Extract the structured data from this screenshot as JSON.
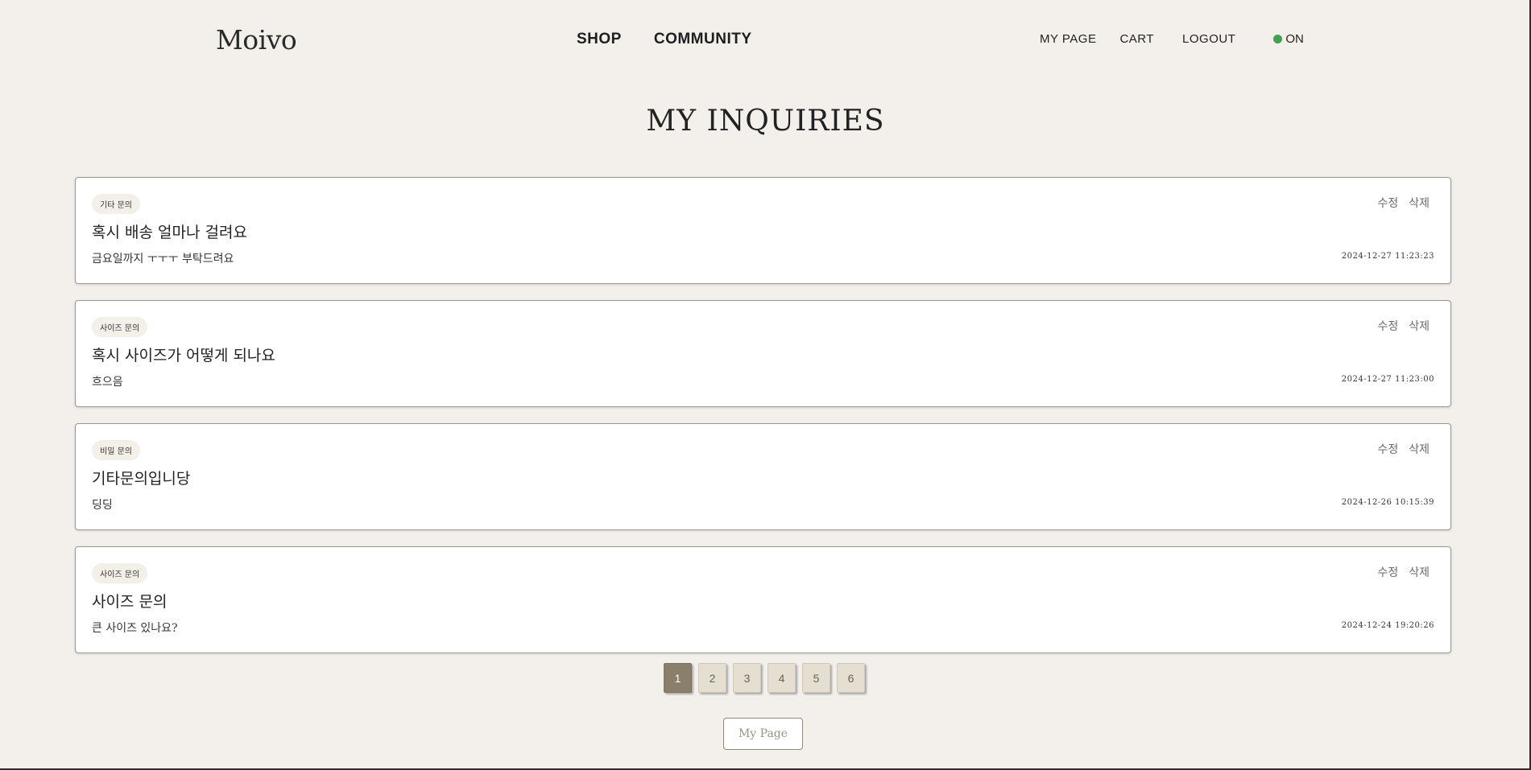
{
  "header": {
    "logo": "Moivo",
    "nav": {
      "shop": "SHOP",
      "community": "COMMUNITY"
    },
    "user_nav": {
      "my_page": "MY PAGE",
      "cart": "CART",
      "logout": "LOGOUT"
    },
    "status": {
      "label": "ON",
      "color": "#3fa34d"
    }
  },
  "page": {
    "title": "MY INQUIRIES"
  },
  "inquiries": [
    {
      "category": "기타 문의",
      "title": "혹시 배송 얼마나 걸려요",
      "content": "금요일까지 ㅜㅜㅜ 부탁드려요",
      "date": "2024-12-27 11:23:23",
      "edit_label": "수정",
      "delete_label": "삭제"
    },
    {
      "category": "사이즈 문의",
      "title": "혹시 사이즈가 어떻게 되나요",
      "content": "흐으음",
      "date": "2024-12-27 11:23:00",
      "edit_label": "수정",
      "delete_label": "삭제"
    },
    {
      "category": "비밀 문의",
      "title": "기타문의입니당",
      "content": "딩딩",
      "date": "2024-12-26 10:15:39",
      "edit_label": "수정",
      "delete_label": "삭제"
    },
    {
      "category": "사이즈 문의",
      "title": "사이즈 문의",
      "content": "큰 사이즈 있나요?",
      "date": "2024-12-24 19:20:26",
      "edit_label": "수정",
      "delete_label": "삭제"
    }
  ],
  "pagination": {
    "pages": [
      "1",
      "2",
      "3",
      "4",
      "5",
      "6"
    ],
    "current": "1"
  },
  "footer": {
    "my_page_button": "My Page"
  }
}
